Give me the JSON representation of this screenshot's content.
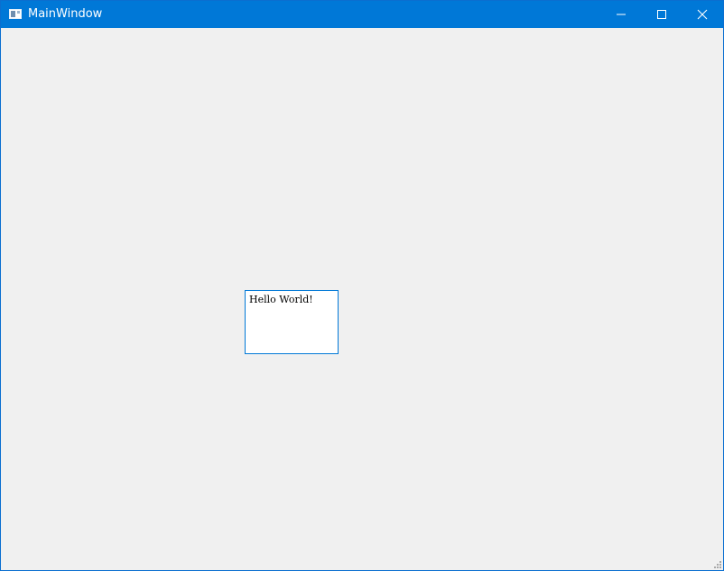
{
  "window": {
    "title": "MainWindow",
    "accent_color": "#0078d7",
    "background_color": "#f0f0f0",
    "icons": {
      "app": "app-window-icon",
      "minimize": "minimize-icon",
      "maximize": "maximize-icon",
      "close": "close-icon",
      "resize": "size-grip-icon"
    }
  },
  "content": {
    "text_box_value": "Hello World!"
  }
}
